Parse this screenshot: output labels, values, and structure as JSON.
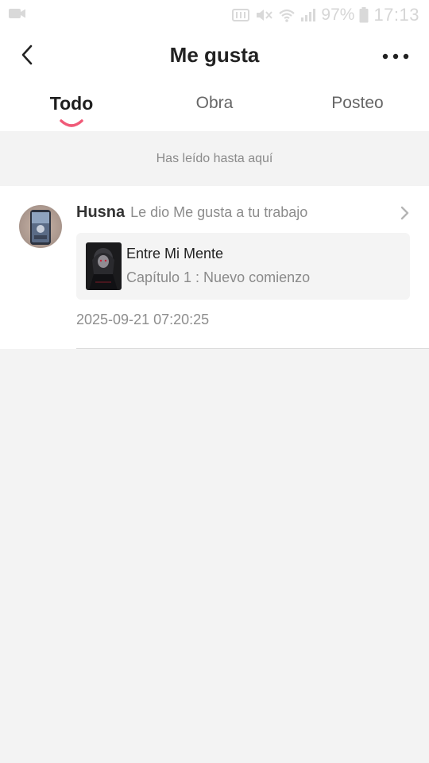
{
  "status_bar": {
    "battery": "97%",
    "time": "17:13",
    "icons": [
      "video-camera-icon",
      "nfc-icon",
      "mute-icon",
      "wifi-icon",
      "signal-icon",
      "battery-icon"
    ]
  },
  "header": {
    "title": "Me gusta",
    "back_icon": "back-arrow-icon",
    "more_icon": "more-dots-icon"
  },
  "tabs": [
    {
      "label": "Todo",
      "active": true
    },
    {
      "label": "Obra",
      "active": false
    },
    {
      "label": "Posteo",
      "active": false
    }
  ],
  "notice": {
    "text": "Has leído hasta aquí"
  },
  "notifications": [
    {
      "user": "Husna",
      "action": "Le dio Me gusta a tu trabajo",
      "work_title": "Entre Mi Mente",
      "work_chapter": "Capítulo 1 : Nuevo comienzo",
      "timestamp": "2025-09-21 07:20:25"
    }
  ],
  "colors": {
    "accent": "#f05a78",
    "background": "#f3f3f3",
    "surface": "#ffffff"
  }
}
